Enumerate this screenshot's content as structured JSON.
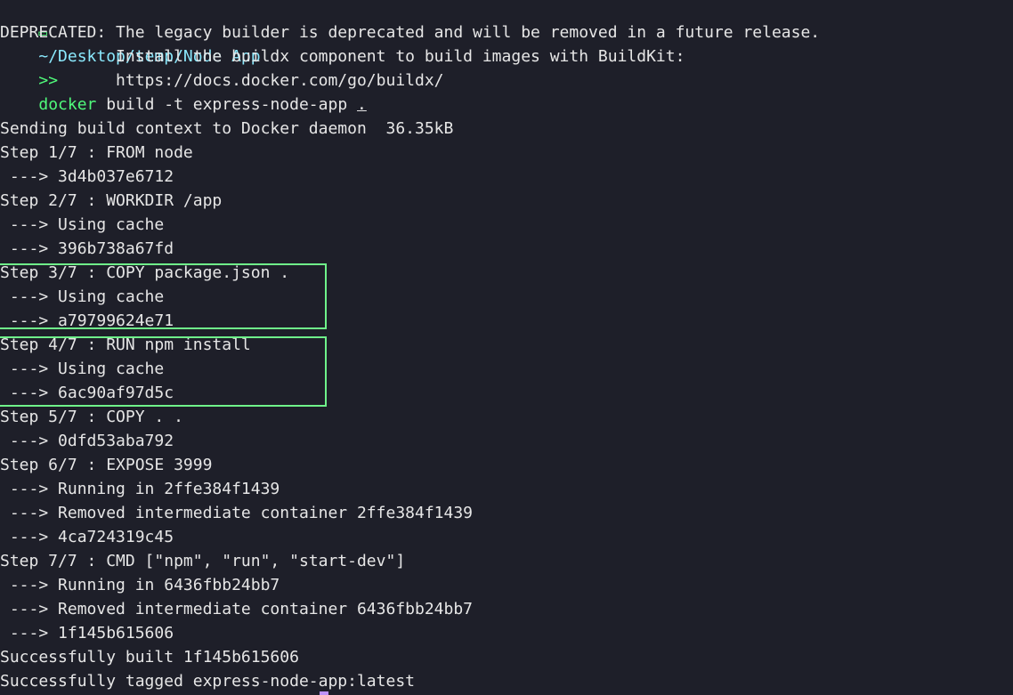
{
  "prompt": {
    "folder_icon": "folder-icon",
    "path": "~/Desktop/temp/Node App",
    "arrow": ">>",
    "command_name": "docker",
    "command_args": " build -t express-node-app ",
    "command_target": "."
  },
  "output_lines": [
    "DEPRECATED: The legacy builder is deprecated and will be removed in a future release.",
    "            Install the buildx component to build images with BuildKit:",
    "            https://docs.docker.com/go/buildx/",
    "",
    "Sending build context to Docker daemon  36.35kB",
    "Step 1/7 : FROM node",
    " ---> 3d4b037e6712",
    "Step 2/7 : WORKDIR /app",
    " ---> Using cache",
    " ---> 396b738a67fd",
    "Step 3/7 : COPY package.json .",
    " ---> Using cache",
    " ---> a79799624e71",
    "Step 4/7 : RUN npm install",
    " ---> Using cache",
    " ---> 6ac90af97d5c",
    "Step 5/7 : COPY . .",
    " ---> 0dfd53aba792",
    "Step 6/7 : EXPOSE 3999",
    " ---> Running in 2ffe384f1439",
    " ---> Removed intermediate container 2ffe384f1439",
    " ---> 4ca724319c45",
    "Step 7/7 : CMD [\"npm\", \"run\", \"start-dev\"]",
    " ---> Running in 6436fbb24bb7",
    " ---> Removed intermediate container 6436fbb24bb7",
    " ---> 1f145b615606",
    "Successfully built 1f145b615606",
    "Successfully tagged express-node-app:latest"
  ],
  "colors": {
    "background": "#1e1f29",
    "text": "#e6e6e6",
    "prompt_path": "#8be9fd",
    "prompt_accent": "#50fa7b",
    "highlight_border": "#6ff28a",
    "cursor": "#bd93f9"
  }
}
